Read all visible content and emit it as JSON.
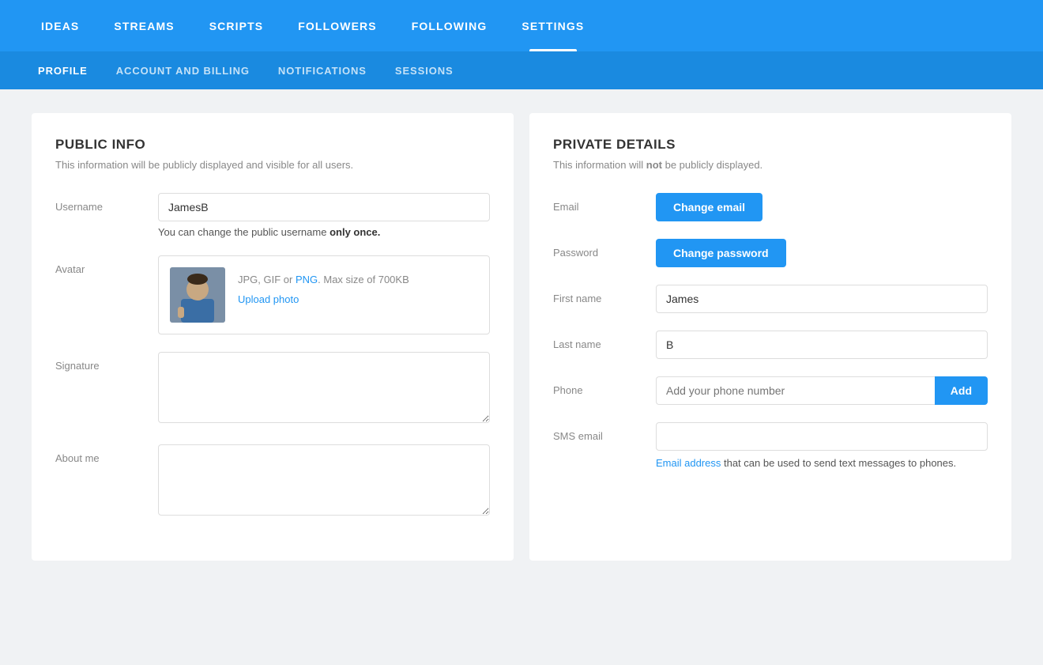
{
  "topNav": {
    "items": [
      {
        "label": "IDEAS",
        "href": "#",
        "active": false
      },
      {
        "label": "STREAMS",
        "href": "#",
        "active": false
      },
      {
        "label": "SCRIPTS",
        "href": "#",
        "active": false
      },
      {
        "label": "FOLLOWERS",
        "href": "#",
        "active": false
      },
      {
        "label": "FOLLOWING",
        "href": "#",
        "active": false
      },
      {
        "label": "SETTINGS",
        "href": "#",
        "active": true
      }
    ]
  },
  "subNav": {
    "items": [
      {
        "label": "PROFILE",
        "href": "#",
        "active": true
      },
      {
        "label": "ACCOUNT AND BILLING",
        "href": "#",
        "active": false
      },
      {
        "label": "NOTIFICATIONS",
        "href": "#",
        "active": false
      },
      {
        "label": "SESSIONS",
        "href": "#",
        "active": false
      }
    ]
  },
  "publicInfo": {
    "title": "PUBLIC INFO",
    "subtitle": "This information will be publicly displayed and visible for all users.",
    "usernameLabel": "Username",
    "usernameValue": "JamesB",
    "usernameHint1": "You can change the public username ",
    "usernameHintStrong": "only once.",
    "avatarLabel": "Avatar",
    "avatarHint": "JPG, GIF or ",
    "avatarPng": "PNG",
    "avatarHint2": ". Max size of 700KB",
    "uploadLink": "Upload photo",
    "signatureLabel": "Signature",
    "signaturePlaceholder": "",
    "aboutLabel": "About me",
    "aboutPlaceholder": ""
  },
  "privateDetails": {
    "title": "PRIVATE DETAILS",
    "subtitle": "This information will not be publicly displayed.",
    "emailLabel": "Email",
    "changeEmailBtn": "Change email",
    "passwordLabel": "Password",
    "changePasswordBtn": "Change password",
    "firstNameLabel": "First name",
    "firstNameValue": "James",
    "lastNameLabel": "Last name",
    "lastNameValue": "B",
    "phoneLabel": "Phone",
    "phonePlaceholder": "Add your phone number",
    "phoneAddBtn": "Add",
    "smsEmailLabel": "SMS email",
    "smsEmailValue": "",
    "smsHint1": "Email address",
    "smsHint2": " that can be used to send text messages to phones."
  }
}
